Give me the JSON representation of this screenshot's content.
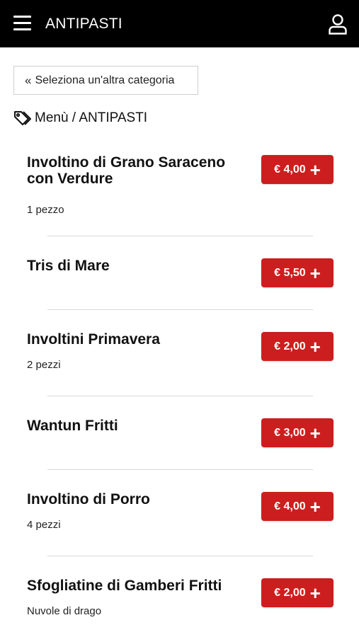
{
  "header": {
    "title": "ANTIPASTI"
  },
  "back_button": {
    "label": "Seleziona un'altra categoria"
  },
  "breadcrumb": {
    "text": "Menù / ANTIPASTI"
  },
  "items": [
    {
      "name": "Involtino di Grano Saraceno con Verdure",
      "desc": "1 pezzo",
      "price": "€ 4,00"
    },
    {
      "name": "Tris di Mare",
      "desc": "",
      "price": "€ 5,50"
    },
    {
      "name": "Involtini Primavera",
      "desc": "2 pezzi",
      "price": "€ 2,00"
    },
    {
      "name": "Wantun Fritti",
      "desc": "",
      "price": "€ 3,00"
    },
    {
      "name": "Involtino di Porro",
      "desc": "4 pezzi",
      "price": "€ 4,00"
    },
    {
      "name": "Sfogliatine di Gamberi Fritti",
      "desc": "Nuvole di drago",
      "price": "€ 2,00"
    }
  ],
  "colors": {
    "topbar": "#000000",
    "accent": "#cc1e1e"
  },
  "icons": {
    "menu": "hamburger-icon",
    "user": "user-icon",
    "back": "double-chevron-left-icon",
    "tag": "tag-icon",
    "add": "plus-icon"
  }
}
